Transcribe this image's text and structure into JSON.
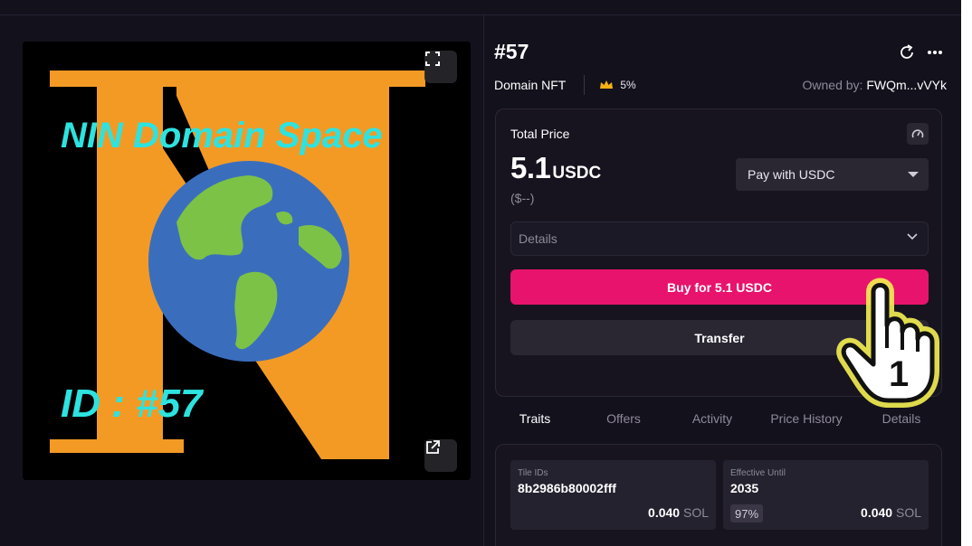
{
  "image": {
    "headline": "NIN Domain Space",
    "id_text": "ID : #57",
    "letter": "N",
    "colors": {
      "background": "#000000",
      "letter": "#f39a25",
      "text": "#2de3e0",
      "ocean": "#3a6ebd",
      "land": "#7cc246"
    }
  },
  "item": {
    "title": "#57",
    "collection": "Domain NFT",
    "royalty": "5%",
    "owner_label": "Owned by:",
    "owner": "FWQm...vVYk"
  },
  "price": {
    "label": "Total Price",
    "value": "5.1",
    "currency": "USDC",
    "usd": "($--)",
    "pay_with": "Pay with USDC",
    "details_label": "Details",
    "buy_label": "Buy for 5.1 USDC",
    "transfer_label": "Transfer"
  },
  "tabs": [
    "Traits",
    "Offers",
    "Activity",
    "Price History",
    "Details"
  ],
  "traits": [
    {
      "type": "Tile IDs",
      "value": "8b2986b80002fff",
      "price": "0.040",
      "unit": "SOL",
      "pct": ""
    },
    {
      "type": "Effective Until",
      "value": "2035",
      "price": "0.040",
      "unit": "SOL",
      "pct": "97%"
    }
  ],
  "annotation": {
    "step": "1"
  },
  "colors": {
    "accent": "#e8136c",
    "bg": "#13111c",
    "muted": "#8e8a99"
  }
}
